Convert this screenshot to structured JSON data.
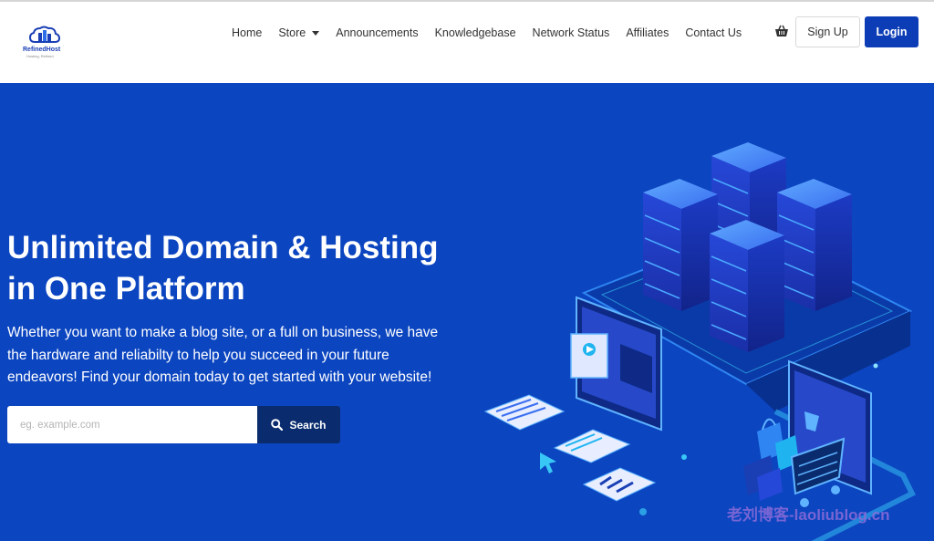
{
  "header": {
    "logo": {
      "name": "RefinedHost",
      "tagline": "Hosting, Refined"
    },
    "nav": [
      {
        "label": "Home"
      },
      {
        "label": "Store",
        "dropdown": true
      },
      {
        "label": "Announcements"
      },
      {
        "label": "Knowledgebase"
      },
      {
        "label": "Network Status"
      },
      {
        "label": "Affiliates"
      },
      {
        "label": "Contact Us"
      }
    ],
    "cart_icon": "shopping-basket-icon",
    "signup_label": "Sign Up",
    "login_label": "Login"
  },
  "hero": {
    "title": "Unlimited Domain & Hosting in One Platform",
    "subtitle": "Whether you want to make a blog site, or a full on business, we have the hardware and reliabilty to help you succeed in your future endeavors! Find your domain today to get started with your website!",
    "search": {
      "placeholder": "eg. example.com",
      "value": "",
      "button_label": "Search",
      "button_icon": "search-icon"
    },
    "watermark": "老刘博客-laoliublog.cn"
  },
  "colors": {
    "hero_bg": "#0b45c0",
    "login_bg": "#0d3db6",
    "search_btn_bg": "#0a2c6e",
    "accent_cyan": "#39c8f5"
  }
}
